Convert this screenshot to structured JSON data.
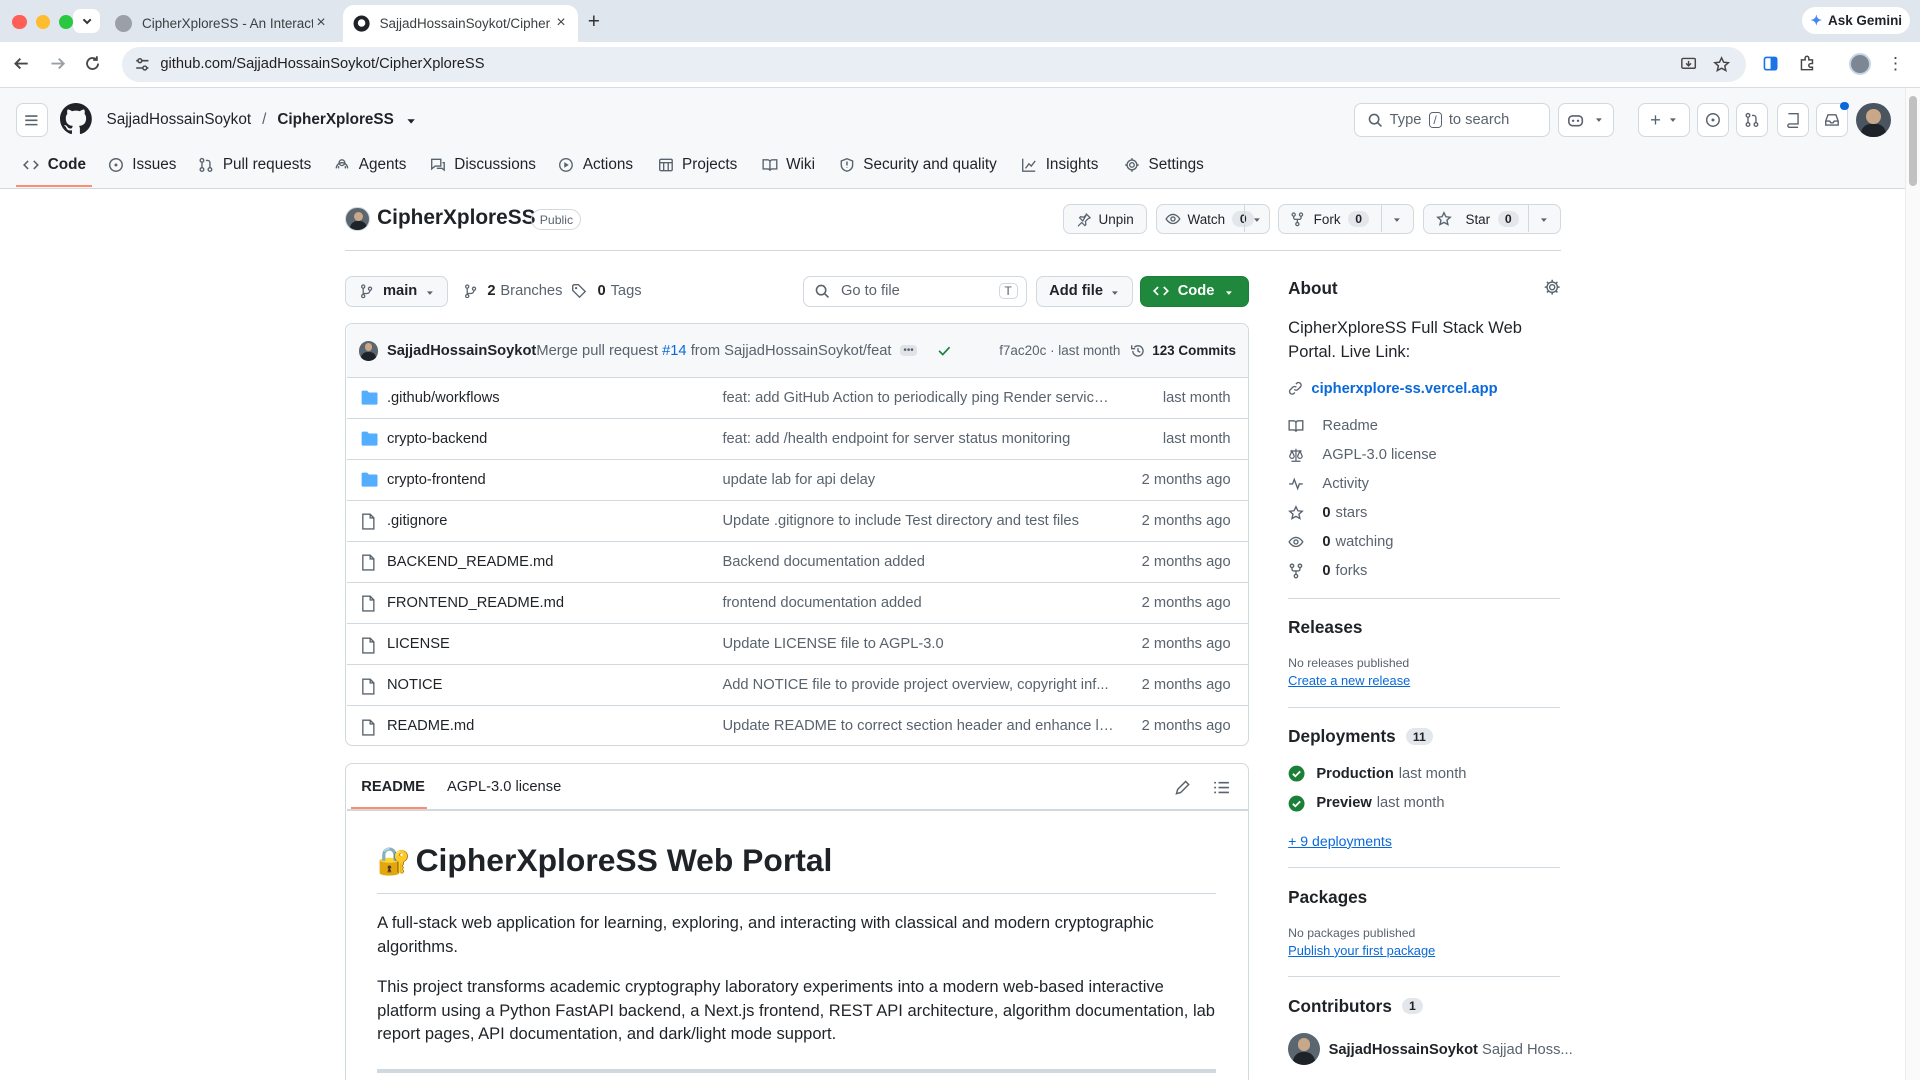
{
  "browser": {
    "tabs": [
      {
        "title": "CipherXploreSS - An Interacti"
      },
      {
        "title": "SajjadHossainSoykot/CipherX"
      }
    ],
    "url": "github.com/SajjadHossainSoykot/CipherXploreSS",
    "gemini_label": "Ask Gemini"
  },
  "header": {
    "owner": "SajjadHossainSoykot",
    "slash": "/",
    "repo": "CipherXploreSS",
    "search_prefix": "Type",
    "search_key": "/",
    "search_suffix": "to search"
  },
  "nav": [
    {
      "label": "Code",
      "icon": "code-icon"
    },
    {
      "label": "Issues",
      "icon": "issue-icon"
    },
    {
      "label": "Pull requests",
      "icon": "pull-request-icon"
    },
    {
      "label": "Agents",
      "icon": "agent-icon"
    },
    {
      "label": "Discussions",
      "icon": "discussion-icon"
    },
    {
      "label": "Actions",
      "icon": "play-icon"
    },
    {
      "label": "Projects",
      "icon": "table-icon"
    },
    {
      "label": "Wiki",
      "icon": "book-icon"
    },
    {
      "label": "Security and quality",
      "icon": "shield-icon"
    },
    {
      "label": "Insights",
      "icon": "graph-icon"
    },
    {
      "label": "Settings",
      "icon": "gear-icon"
    }
  ],
  "repo": {
    "name": "CipherXploreSS",
    "visibility": "Public",
    "unpin": "Unpin",
    "watch": "Watch",
    "watch_count": "0",
    "fork": "Fork",
    "fork_count": "0",
    "star": "Star",
    "star_count": "0"
  },
  "branchbar": {
    "branch": "main",
    "branches_count": "2",
    "branches_label": "Branches",
    "tags_count": "0",
    "tags_label": "Tags",
    "goto_placeholder": "Go to file",
    "goto_key": "T",
    "add_file": "Add file",
    "code": "Code"
  },
  "commit": {
    "author": "SajjadHossainSoykot",
    "msg_prefix": "Merge pull request",
    "pr": "#14",
    "msg_suffix": "from SajjadHossainSoykot/feat",
    "sha": "f7ac20c",
    "dot": "·",
    "time": "last month",
    "commits": "123 Commits"
  },
  "files": [
    {
      "type": "dir",
      "name": ".github/workflows",
      "msg": "feat: add GitHub Action to periodically ping Render service...",
      "time": "last month"
    },
    {
      "type": "dir",
      "name": "crypto-backend",
      "msg": "feat: add /health endpoint for server status monitoring",
      "time": "last month"
    },
    {
      "type": "dir",
      "name": "crypto-frontend",
      "msg": "update lab for api delay",
      "time": "2 months ago"
    },
    {
      "type": "file",
      "name": ".gitignore",
      "msg": "Update .gitignore to include Test directory and test files",
      "time": "2 months ago"
    },
    {
      "type": "file",
      "name": "BACKEND_README.md",
      "msg": "Backend documentation added",
      "time": "2 months ago"
    },
    {
      "type": "file",
      "name": "FRONTEND_README.md",
      "msg": "frontend documentation added",
      "time": "2 months ago"
    },
    {
      "type": "file",
      "name": "LICENSE",
      "msg": "Update LICENSE file to AGPL-3.0",
      "time": "2 months ago"
    },
    {
      "type": "file",
      "name": "NOTICE",
      "msg": "Add NOTICE file to provide project overview, copyright inf...",
      "time": "2 months ago"
    },
    {
      "type": "file",
      "name": "README.md",
      "msg": "Update README to correct section header and enhance li...",
      "time": "2 months ago"
    }
  ],
  "readme": {
    "tab_readme": "README",
    "tab_license": "AGPL-3.0 license",
    "emoji": "🔐",
    "title": "CipherXploreSS Web Portal",
    "p1": "A full-stack web application for learning, exploring, and interacting with classical and modern cryptographic algorithms.",
    "p2": "This project transforms academic cryptography laboratory experiments into a modern web-based interactive platform using a Python FastAPI backend, a Next.js frontend, REST API architecture, algorithm documentation, lab report pages, API documentation, and dark/light mode support."
  },
  "about": {
    "heading": "About",
    "description": "CipherXploreSS Full Stack Web Portal. Live Link:",
    "link": "cipherxplore-ss.vercel.app",
    "items": [
      {
        "icon": "book-icon",
        "count": "",
        "label": "Readme"
      },
      {
        "icon": "law-icon",
        "count": "",
        "label": "AGPL-3.0 license"
      },
      {
        "icon": "pulse-icon",
        "count": "",
        "label": "Activity"
      },
      {
        "icon": "star-icon",
        "count": "0",
        "label": "stars"
      },
      {
        "icon": "eye-icon",
        "count": "0",
        "label": "watching"
      },
      {
        "icon": "fork-icon",
        "count": "0",
        "label": "forks"
      }
    ]
  },
  "releases": {
    "heading": "Releases",
    "none": "No releases published",
    "link": "Create a new release"
  },
  "deployments": {
    "heading": "Deployments",
    "count": "11",
    "items": [
      {
        "name": "Production",
        "time": "last month"
      },
      {
        "name": "Preview",
        "time": "last month"
      }
    ],
    "more": "+ 9 deployments"
  },
  "packages": {
    "heading": "Packages",
    "none": "No packages published",
    "link": "Publish your first package"
  },
  "contributors": {
    "heading": "Contributors",
    "count": "1",
    "login": "SajjadHossainSoykot",
    "name": "Sajjad Hoss..."
  },
  "colors": {
    "accent": "#0969da",
    "green": "#1f883d",
    "folder": "#54aeff",
    "underline": "#fd8c73"
  }
}
